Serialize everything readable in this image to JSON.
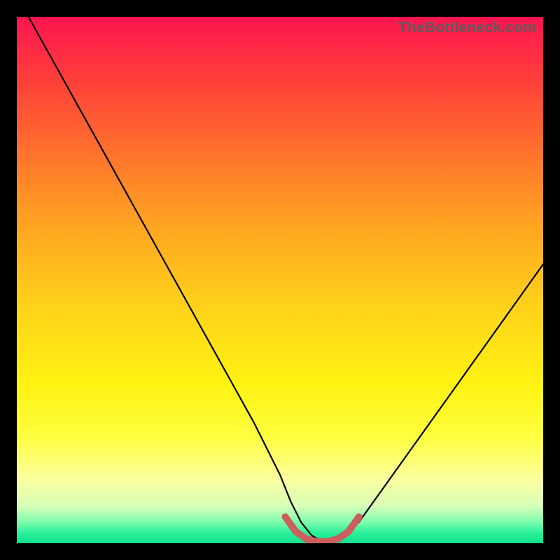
{
  "watermark": "TheBottleneck.com",
  "chart_data": {
    "type": "line",
    "title": "",
    "xlabel": "",
    "ylabel": "",
    "xlim": [
      0,
      100
    ],
    "ylim": [
      0,
      100
    ],
    "series": [
      {
        "name": "bottleneck-curve",
        "color": "#000000",
        "x": [
          0,
          5,
          10,
          15,
          20,
          25,
          30,
          35,
          40,
          45,
          50,
          52,
          54,
          56,
          58,
          60,
          62,
          65,
          70,
          75,
          80,
          85,
          90,
          95,
          100
        ],
        "values": [
          104,
          95,
          86,
          77,
          68,
          59,
          50,
          41,
          32,
          23,
          13,
          8,
          4,
          1.5,
          0.3,
          0.3,
          1.5,
          4,
          11,
          18,
          25,
          32,
          39,
          46,
          53
        ]
      },
      {
        "name": "optimal-band",
        "color": "#cc5e5e",
        "x": [
          51,
          53,
          55,
          57,
          59,
          61,
          63,
          65
        ],
        "values": [
          5,
          2.2,
          0.8,
          0.3,
          0.3,
          0.8,
          2.2,
          5
        ]
      }
    ]
  }
}
